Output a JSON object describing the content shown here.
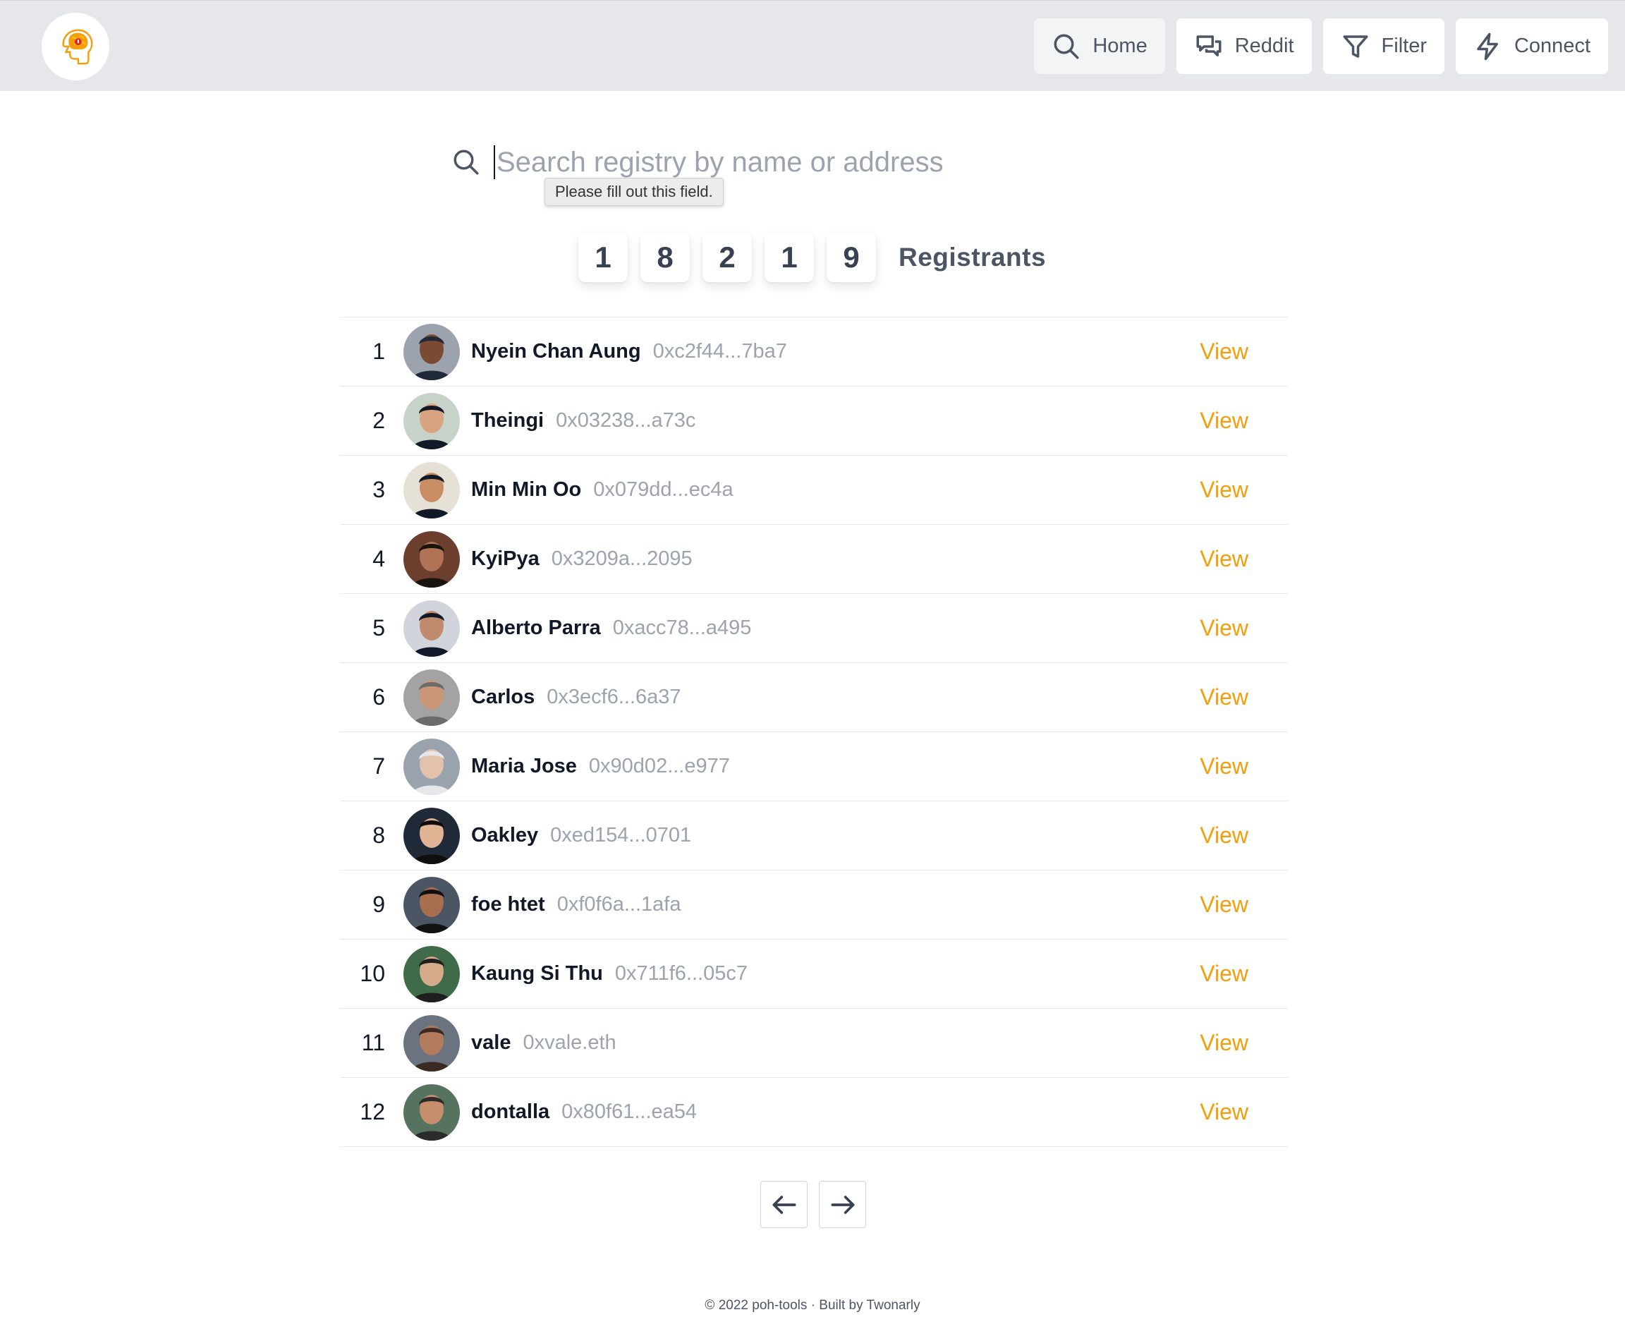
{
  "nav": {
    "home": "Home",
    "reddit": "Reddit",
    "filter": "Filter",
    "connect": "Connect"
  },
  "search": {
    "placeholder": "Search registry by name or address",
    "tooltip": "Please fill out this field."
  },
  "counter": {
    "digits": [
      "1",
      "8",
      "2",
      "1",
      "9"
    ],
    "label": "Registrants"
  },
  "registrants": [
    {
      "rank": "1",
      "name": "Nyein Chan Aung",
      "address": "0xc2f44...7ba7",
      "action": "View"
    },
    {
      "rank": "2",
      "name": "Theingi",
      "address": "0x03238...a73c",
      "action": "View"
    },
    {
      "rank": "3",
      "name": "Min Min Oo",
      "address": "0x079dd...ec4a",
      "action": "View"
    },
    {
      "rank": "4",
      "name": "KyiPya",
      "address": "0x3209a...2095",
      "action": "View"
    },
    {
      "rank": "5",
      "name": "Alberto Parra",
      "address": "0xacc78...a495",
      "action": "View"
    },
    {
      "rank": "6",
      "name": "Carlos",
      "address": "0x3ecf6...6a37",
      "action": "View"
    },
    {
      "rank": "7",
      "name": "Maria Jose",
      "address": "0x90d02...e977",
      "action": "View"
    },
    {
      "rank": "8",
      "name": "Oakley",
      "address": "0xed154...0701",
      "action": "View"
    },
    {
      "rank": "9",
      "name": "foe htet",
      "address": "0xf0f6a...1afa",
      "action": "View"
    },
    {
      "rank": "10",
      "name": "Kaung Si Thu",
      "address": "0x711f6...05c7",
      "action": "View"
    },
    {
      "rank": "11",
      "name": "vale",
      "address": "0xvale.eth",
      "action": "View"
    },
    {
      "rank": "12",
      "name": "dontalla",
      "address": "0x80f61...ea54",
      "action": "View"
    }
  ],
  "footer": "© 2022 poh-tools · Built by Twonarly",
  "colors": {
    "accent": "#f59e0b",
    "header_bg": "#e5e7eb",
    "muted_text": "#9ca3af"
  }
}
